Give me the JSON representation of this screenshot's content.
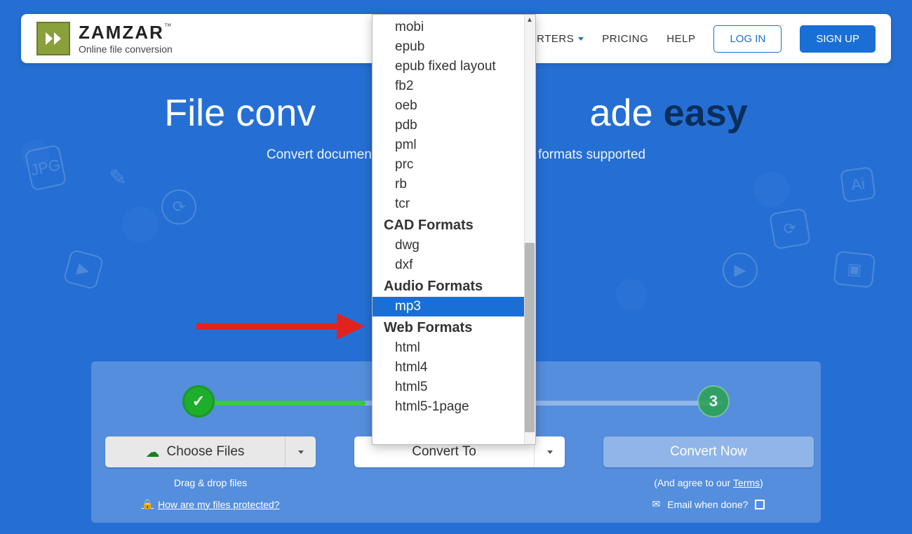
{
  "header": {
    "brand": "ZAMZAR",
    "brand_tm": "™",
    "tagline": "Online file conversion",
    "nav": {
      "converters": "CONVERTERS",
      "pricing": "PRICING",
      "help": "HELP",
      "login": "LOG IN",
      "signup": "SIGN UP"
    }
  },
  "hero": {
    "title_pre": "File conv",
    "title_mid": "ade",
    "title_easy": "easy",
    "subtitle_pre": "Convert documents,",
    "subtitle_post": "+ formats supported"
  },
  "steps": {
    "step1": "✓",
    "step3": "3"
  },
  "actions": {
    "choose_files": "Choose Files",
    "convert_to": "Convert To",
    "convert_now": "Convert Now",
    "drag_drop": "Drag & drop files",
    "protected": "How are my files protected?",
    "agree_pre": "(And agree to our ",
    "terms": "Terms",
    "agree_post": ")",
    "email_done": "Email when done?"
  },
  "dropdown": {
    "items": [
      {
        "type": "opt",
        "label": "mobi"
      },
      {
        "type": "opt",
        "label": "epub"
      },
      {
        "type": "opt",
        "label": "epub fixed layout"
      },
      {
        "type": "opt",
        "label": "fb2"
      },
      {
        "type": "opt",
        "label": "oeb"
      },
      {
        "type": "opt",
        "label": "pdb"
      },
      {
        "type": "opt",
        "label": "pml"
      },
      {
        "type": "opt",
        "label": "prc"
      },
      {
        "type": "opt",
        "label": "rb"
      },
      {
        "type": "opt",
        "label": "tcr"
      },
      {
        "type": "group",
        "label": "CAD Formats"
      },
      {
        "type": "opt",
        "label": "dwg"
      },
      {
        "type": "opt",
        "label": "dxf"
      },
      {
        "type": "group",
        "label": "Audio Formats"
      },
      {
        "type": "opt",
        "label": "mp3",
        "selected": true
      },
      {
        "type": "group",
        "label": "Web Formats"
      },
      {
        "type": "opt",
        "label": "html"
      },
      {
        "type": "opt",
        "label": "html4"
      },
      {
        "type": "opt",
        "label": "html5"
      },
      {
        "type": "opt",
        "label": "html5-1page"
      }
    ]
  }
}
